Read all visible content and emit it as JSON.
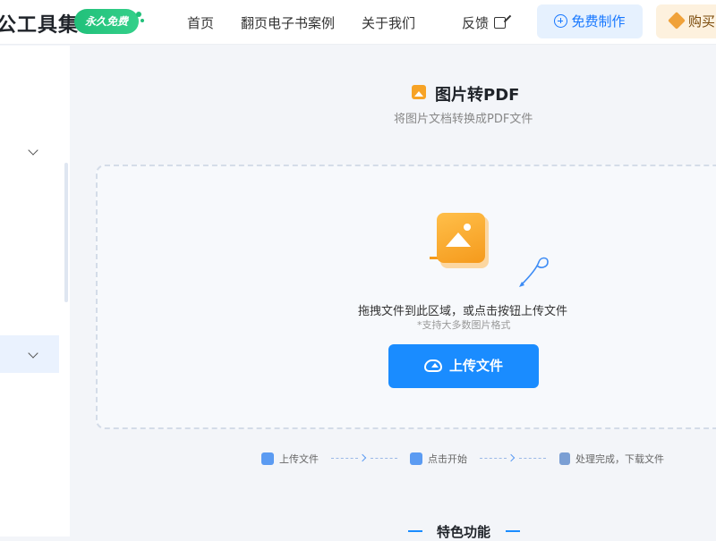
{
  "header": {
    "logo_text": "公工具集",
    "free_badge": "永久免费",
    "nav": [
      "首页",
      "翻页电子书案例",
      "关于我们",
      "反馈"
    ],
    "free_make_label": "免费制作",
    "buy_label": "购买"
  },
  "main": {
    "title": "图片转PDF",
    "subtitle": "将图片文档转换成PDF文件",
    "drop_text": "拖拽文件到此区域，或点击按钮上传文件",
    "drop_hint": "*支持大多数图片格式",
    "upload_button": "上传文件",
    "steps": [
      "上传文件",
      "点击开始",
      "处理完成，下载文件"
    ],
    "features_title": "特色功能"
  },
  "colors": {
    "accent": "#1a8cff",
    "free_badge": "#21c07a",
    "buy_bg": "#fdf1de",
    "illustration": "#f59a1c"
  }
}
